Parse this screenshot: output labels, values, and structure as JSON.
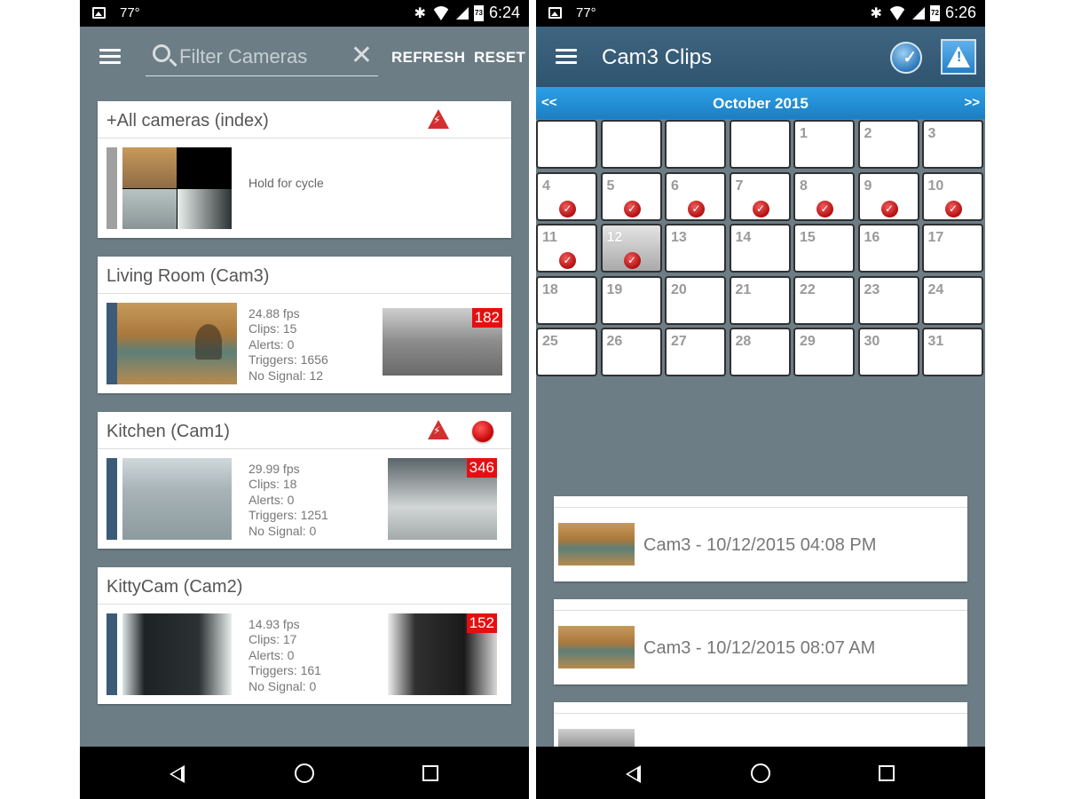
{
  "left": {
    "status": {
      "temp": "77°",
      "battery": "73",
      "time": "6:24"
    },
    "toolbar": {
      "search_placeholder": "Filter Cameras",
      "clear": "✕",
      "refresh": "REFRESH",
      "reset": "RESET"
    },
    "cameras": [
      {
        "title": "+All cameras (index)",
        "hold": "Hold for cycle"
      },
      {
        "title": "Living Room (Cam3)",
        "fps": "24.88 fps",
        "clips": "Clips: 15",
        "alerts": "Alerts: 0",
        "triggers": "Triggers: 1656",
        "nosignal": "No Signal: 12",
        "count": "182"
      },
      {
        "title": "Kitchen (Cam1)",
        "fps": "29.99 fps",
        "clips": "Clips: 18",
        "alerts": "Alerts: 0",
        "triggers": "Triggers: 1251",
        "nosignal": "No Signal: 0",
        "count": "346"
      },
      {
        "title": "KittyCam (Cam2)",
        "fps": "14.93 fps",
        "clips": "Clips: 17",
        "alerts": "Alerts: 0",
        "triggers": "Triggers: 161",
        "nosignal": "No Signal: 0",
        "count": "152"
      }
    ]
  },
  "right": {
    "status": {
      "temp": "77°",
      "battery": "72",
      "time": "6:26"
    },
    "title": "Cam3 Clips",
    "calendar": {
      "prev": "<<",
      "next": ">>",
      "month": "October 2015",
      "selected_day": 12,
      "days_with_clips": [
        4,
        5,
        6,
        7,
        8,
        9,
        10,
        11,
        12
      ],
      "cells": [
        "",
        "",
        "",
        "",
        "1",
        "2",
        "3",
        "4",
        "5",
        "6",
        "7",
        "8",
        "9",
        "10",
        "11",
        "12",
        "13",
        "14",
        "15",
        "16",
        "17",
        "18",
        "19",
        "20",
        "21",
        "22",
        "23",
        "24",
        "25",
        "26",
        "27",
        "28",
        "29",
        "30",
        "31"
      ]
    },
    "clips": [
      {
        "label": "Cam3 - 10/12/2015 04:08 PM"
      },
      {
        "label": "Cam3 - 10/12/2015 08:07 AM"
      }
    ]
  },
  "colors": {
    "accent_blue": "#1b7fc4",
    "badge_red": "#e41010",
    "toolbar_grey": "#6c7d86",
    "toolbar_blue": "#3f6581"
  }
}
